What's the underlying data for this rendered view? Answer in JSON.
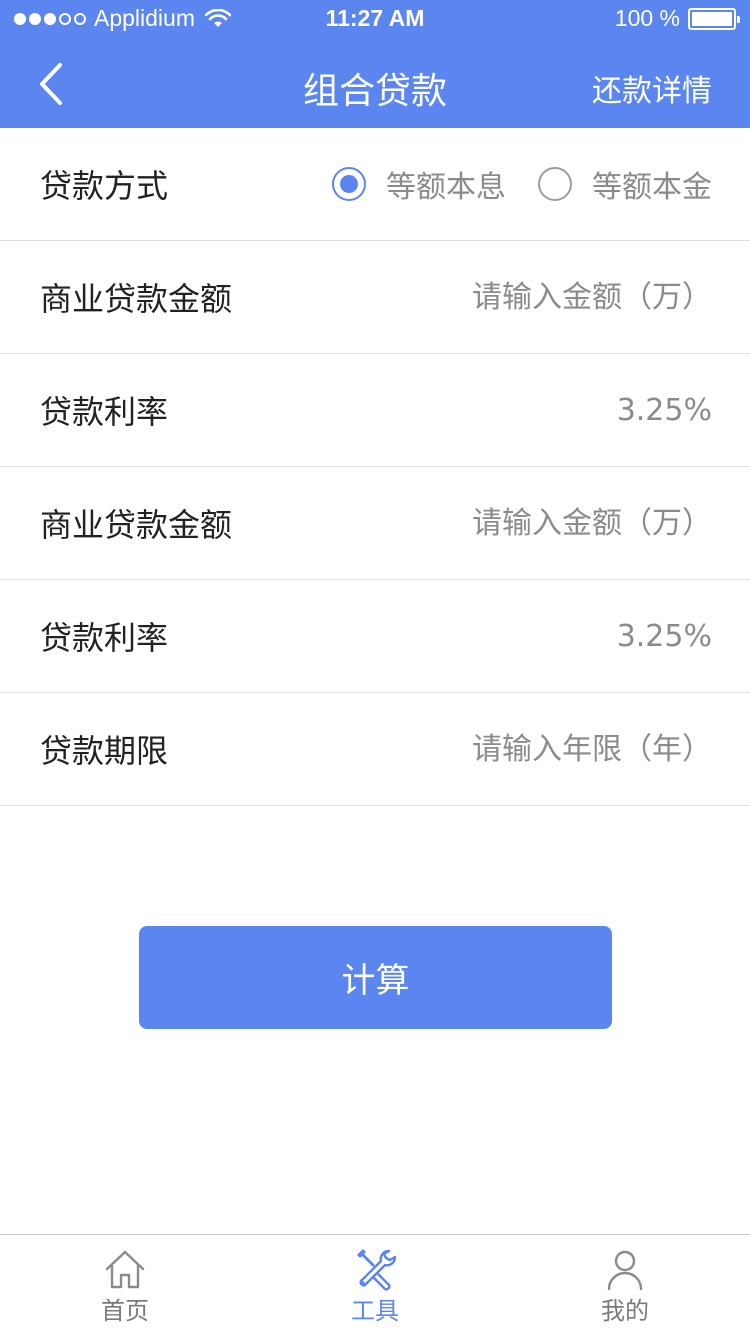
{
  "status_bar": {
    "carrier": "Applidium",
    "time": "11:27 AM",
    "battery": "100 %"
  },
  "nav": {
    "title": "组合贷款",
    "action": "还款详情",
    "back_icon": "chevron-left-icon"
  },
  "form": {
    "method": {
      "label": "贷款方式",
      "options": [
        {
          "label": "等额本息",
          "checked": true
        },
        {
          "label": "等额本金",
          "checked": false
        }
      ]
    },
    "commercial_amount_1": {
      "label": "商业贷款金额",
      "placeholder": "请输入金额（万）"
    },
    "rate_1": {
      "label": "贷款利率",
      "value": "3.25%"
    },
    "commercial_amount_2": {
      "label": "商业贷款金额",
      "placeholder": "请输入金额（万）"
    },
    "rate_2": {
      "label": "贷款利率",
      "value": "3.25%"
    },
    "term": {
      "label": "贷款期限",
      "placeholder": "请输入年限（年）"
    }
  },
  "calculate_label": "计算",
  "tabs": [
    {
      "label": "首页",
      "icon": "home-icon",
      "active": false
    },
    {
      "label": "工具",
      "icon": "tools-icon",
      "active": true
    },
    {
      "label": "我的",
      "icon": "user-icon",
      "active": false
    }
  ],
  "colors": {
    "accent": "#5b86ef",
    "text_primary": "#222222",
    "text_secondary": "#8b8b8b",
    "divider": "#e1e1e1"
  }
}
